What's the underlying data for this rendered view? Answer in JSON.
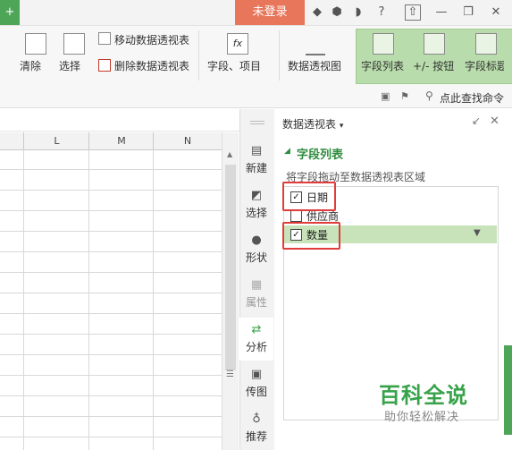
{
  "titlebar": {
    "tab_plus": "+",
    "login_label": "未登录",
    "help_label": "?",
    "minimize": "—",
    "restore": "❐",
    "close": "✕"
  },
  "ribbon": {
    "clear_label": "清除",
    "select_label": "选择",
    "move_pivot_label": "移动数据透视表",
    "delete_pivot_label": "删除数据透视表",
    "field_item_label": "字段、项目",
    "pivot_chart_label": "数据透视图",
    "field_list_label": "字段列表",
    "plusminus_label": "+/- 按钮",
    "field_header_label": "字段标题"
  },
  "search": {
    "label": "点此查找命令"
  },
  "sheet": {
    "columns": [
      "L",
      "M",
      "N"
    ]
  },
  "sidetools": [
    {
      "label": "新建",
      "icon": "new-doc-icon"
    },
    {
      "label": "选择",
      "icon": "select-cursor-icon"
    },
    {
      "label": "形状",
      "icon": "shape-icon"
    },
    {
      "label": "属性",
      "icon": "properties-icon"
    },
    {
      "label": "分析",
      "icon": "analysis-icon"
    },
    {
      "label": "传图",
      "icon": "image-upload-icon"
    },
    {
      "label": "推荐",
      "icon": "recommend-icon"
    }
  ],
  "pane": {
    "title": "数据透视表",
    "section_title": "字段列表",
    "hint": "将字段拖动至数据透视表区域",
    "fields": [
      {
        "label": "日期",
        "checked": true
      },
      {
        "label": "供应商",
        "checked": false
      },
      {
        "label": "数量",
        "checked": true
      }
    ]
  },
  "watermark": {
    "title": "百科全说",
    "subtitle": "助你轻松解决"
  },
  "colors": {
    "accent_green": "#4fa557",
    "login_orange": "#e8765b",
    "highlight_red": "#e03c3c"
  }
}
